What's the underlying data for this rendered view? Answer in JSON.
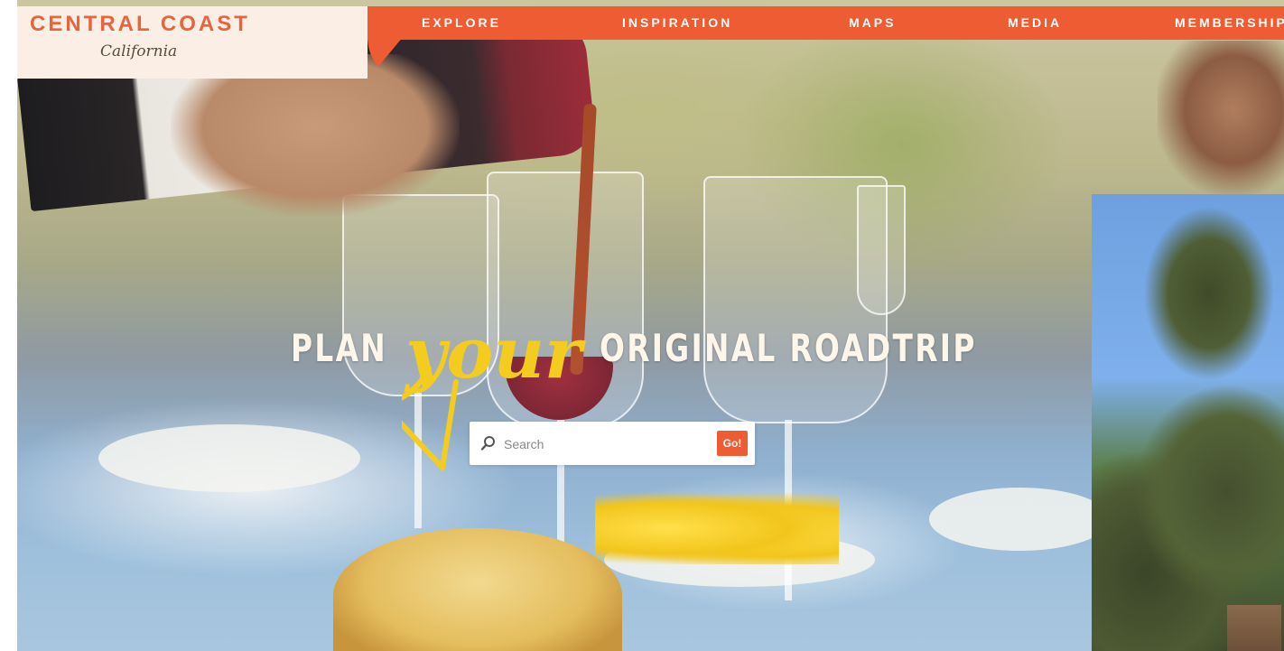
{
  "brand": {
    "title": "CENTRAL COAST",
    "subtitle": "California"
  },
  "nav": {
    "items": [
      {
        "label": "EXPLORE"
      },
      {
        "label": "INSPIRATION"
      },
      {
        "label": "MAPS"
      },
      {
        "label": "MEDIA"
      },
      {
        "label": "MEMBERSHIP"
      }
    ]
  },
  "hero": {
    "headline_left": "PLAN",
    "headline_script": "your",
    "headline_right": "ORIGINAL ROADTRIP"
  },
  "search": {
    "placeholder": "Search",
    "value": "",
    "button_label": "Go!"
  },
  "colors": {
    "accent": "#ee5c33",
    "brand_bg": "#fbefe5",
    "script_yellow": "#f3cc1f"
  }
}
